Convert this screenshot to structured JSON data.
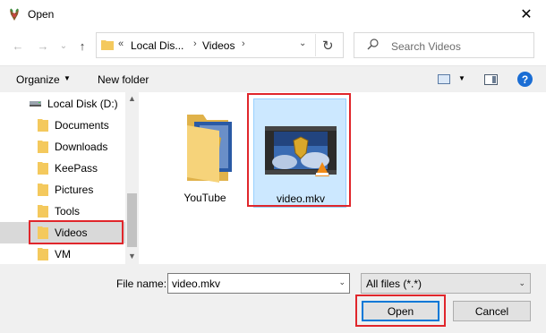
{
  "window": {
    "title": "Open",
    "close_glyph": "✕"
  },
  "nav": {
    "back_glyph": "←",
    "forward_glyph": "→",
    "recent_glyph": "⌄",
    "up_glyph": "↑"
  },
  "address": {
    "overflow": "«",
    "parts": [
      "Local Dis...",
      "Videos"
    ],
    "separator": "›",
    "dropdown_glyph": "⌄",
    "refresh_glyph": "↻"
  },
  "search": {
    "placeholder": "Search Videos",
    "icon": "search-icon"
  },
  "toolbar": {
    "organize_label": "Organize",
    "organize_arrow": "▼",
    "new_folder_label": "New folder",
    "view_arrow": "▼",
    "help_glyph": "?"
  },
  "sidebar": {
    "items": [
      {
        "label": "Local Disk (D:)",
        "icon": "drive-icon"
      },
      {
        "label": "Documents",
        "icon": "folder-icon"
      },
      {
        "label": "Downloads",
        "icon": "folder-icon"
      },
      {
        "label": "KeePass",
        "icon": "folder-icon"
      },
      {
        "label": "Pictures",
        "icon": "folder-icon"
      },
      {
        "label": "Tools",
        "icon": "folder-icon"
      },
      {
        "label": "Videos",
        "icon": "folder-icon",
        "selected": true
      },
      {
        "label": "VM",
        "icon": "folder-icon"
      }
    ],
    "scroll_up": "▲",
    "scroll_down": "▼"
  },
  "files": [
    {
      "name": "YouTube",
      "type": "folder"
    },
    {
      "name": "video.mkv",
      "type": "video",
      "selected": true
    }
  ],
  "footer": {
    "file_name_label": "File name:",
    "file_name_value": "video.mkv",
    "file_name_arrow": "⌄",
    "file_type_value": "All files (*.*)",
    "file_type_arrow": "⌄",
    "open_label": "Open",
    "cancel_label": "Cancel"
  },
  "colors": {
    "highlight": "#e0262b",
    "selection": "#cce8ff",
    "folder": "#f4c95d"
  }
}
